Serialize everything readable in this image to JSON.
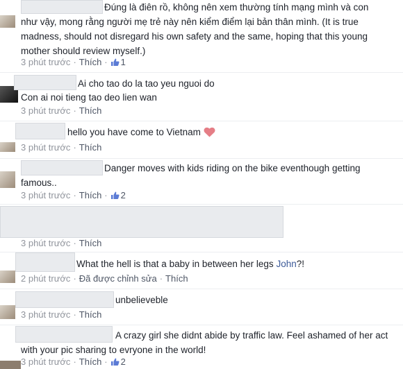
{
  "comments": [
    {
      "text": "Đúng là điên rồ, không nên xem thường tính mạng mình và con như vậy, mong rằng người mẹ trẻ này nên kiểm điểm lại bản thân mình. (It is true madness, should not disregard his own safety and the same, hoping that this young mother should review myself.)",
      "time": "3 phút trước",
      "like_label": "Thích",
      "likes": "1"
    },
    {
      "text_line1": "Ai cho tao do la tao yeu nguoi do",
      "text_line2": "Con ai noi tieng tao deo lien wan",
      "time": "3 phút trước",
      "like_label": "Thích"
    },
    {
      "text": "hello you have come to Vietnam",
      "time": "3 phút trước",
      "like_label": "Thích"
    },
    {
      "text": "Danger moves with kids riding on the bike eventhough getting famous..",
      "time": "3 phút trước",
      "like_label": "Thích",
      "likes": "2"
    },
    {
      "time": "3 phút trước",
      "like_label": "Thích"
    },
    {
      "text": "What the hell is that a baby in between her legs",
      "mention": "John",
      "text_end": "?!",
      "time": "2 phút trước",
      "edited_label": "Đã được chỉnh sửa",
      "like_label": "Thích"
    },
    {
      "text": "unbelieveble",
      "time": "3 phút trước",
      "like_label": "Thích"
    },
    {
      "text": "A crazy girl she didnt abide by traffic law. Feel ashamed of her act with your pic sharing to evryone in the world!",
      "time": "3 phút trước",
      "like_label": "Thích",
      "likes": "2"
    }
  ],
  "colors": {
    "link": "#3b5998",
    "meta": "#90949c",
    "blur": "#e9ebee",
    "heart": "#e57e86"
  }
}
